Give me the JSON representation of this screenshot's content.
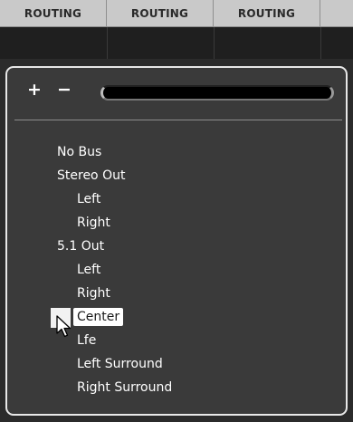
{
  "header": {
    "columns": [
      "ROUTING",
      "ROUTING",
      "ROUTING"
    ]
  },
  "routing_popup": {
    "add_label": "+",
    "remove_label": "−",
    "filter_value": "",
    "items": [
      {
        "label": "No Bus",
        "level": 0
      },
      {
        "label": "Stereo Out",
        "level": 0
      },
      {
        "label": "Left",
        "level": 1
      },
      {
        "label": "Right",
        "level": 1
      },
      {
        "label": "5.1 Out",
        "level": 0
      },
      {
        "label": "Left",
        "level": 1
      },
      {
        "label": "Right",
        "level": 1
      },
      {
        "label": "Center",
        "level": 1,
        "selected": true
      },
      {
        "label": "Lfe",
        "level": 1
      },
      {
        "label": "Left Surround",
        "level": 1
      },
      {
        "label": "Right Surround",
        "level": 1
      }
    ]
  },
  "colors": {
    "header_bg": "#c9c9c9",
    "popup_bg": "#3a3a3a",
    "popup_border": "#e8e8e8",
    "selection_bg": "#ffffff"
  },
  "icons": {
    "pointer": "arrow-cursor-icon"
  }
}
